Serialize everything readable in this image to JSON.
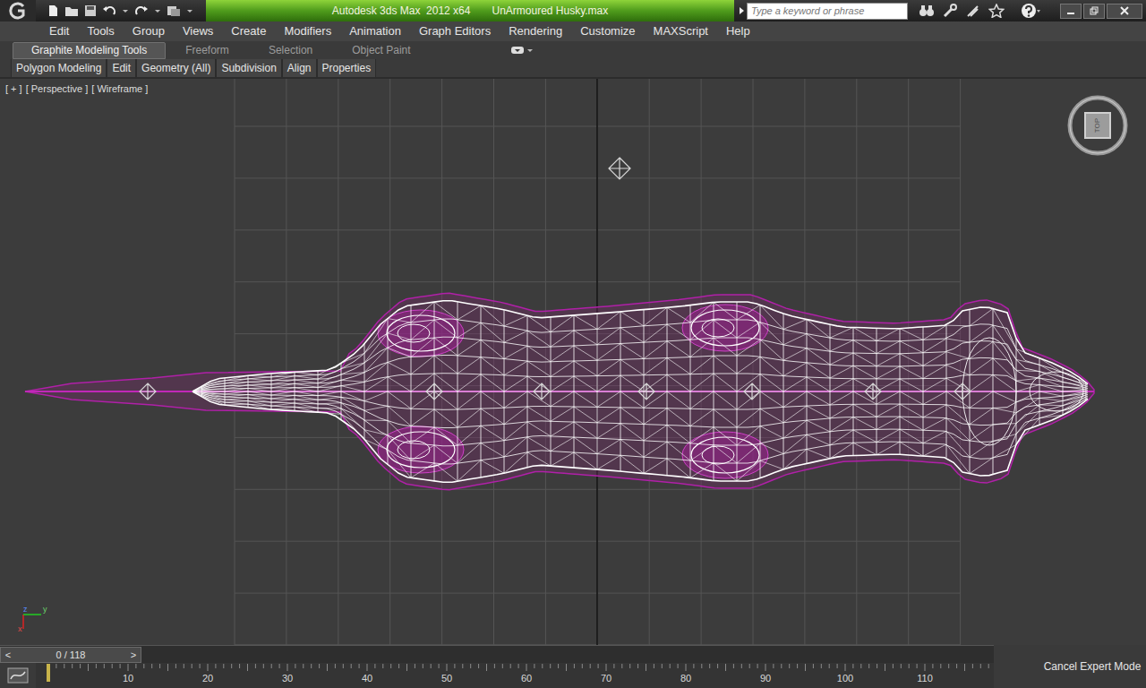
{
  "window": {
    "app_title": "Autodesk 3ds Max  2012 x64",
    "file_name": "UnArmoured Husky.max"
  },
  "search": {
    "placeholder": "Type a keyword or phrase"
  },
  "menu": [
    "Edit",
    "Tools",
    "Group",
    "Views",
    "Create",
    "Modifiers",
    "Animation",
    "Graph Editors",
    "Rendering",
    "Customize",
    "MAXScript",
    "Help"
  ],
  "ribbon_tabs": [
    {
      "label": "Graphite Modeling Tools",
      "selected": true
    },
    {
      "label": "Freeform",
      "selected": false
    },
    {
      "label": "Selection",
      "selected": false
    },
    {
      "label": "Object Paint",
      "selected": false
    }
  ],
  "ribbon_panels": [
    "Polygon Modeling",
    "Edit",
    "Geometry (All)",
    "Subdivision",
    "Align",
    "Properties"
  ],
  "viewport": {
    "labels": [
      "[ + ]",
      "[ Perspective ]",
      "[ Wireframe ]"
    ],
    "viewcube": "TOP",
    "axes": [
      "z",
      "y",
      "x"
    ]
  },
  "time_slider": {
    "prev": "<",
    "position": "0 / 118",
    "next": ">",
    "level": 0
  },
  "track_bar": {
    "ticks": [
      "10",
      "20",
      "30",
      "40",
      "50",
      "60",
      "70",
      "80",
      "90",
      "100",
      "110"
    ]
  },
  "expert_mode": {
    "label": "Cancel Expert Mode"
  }
}
